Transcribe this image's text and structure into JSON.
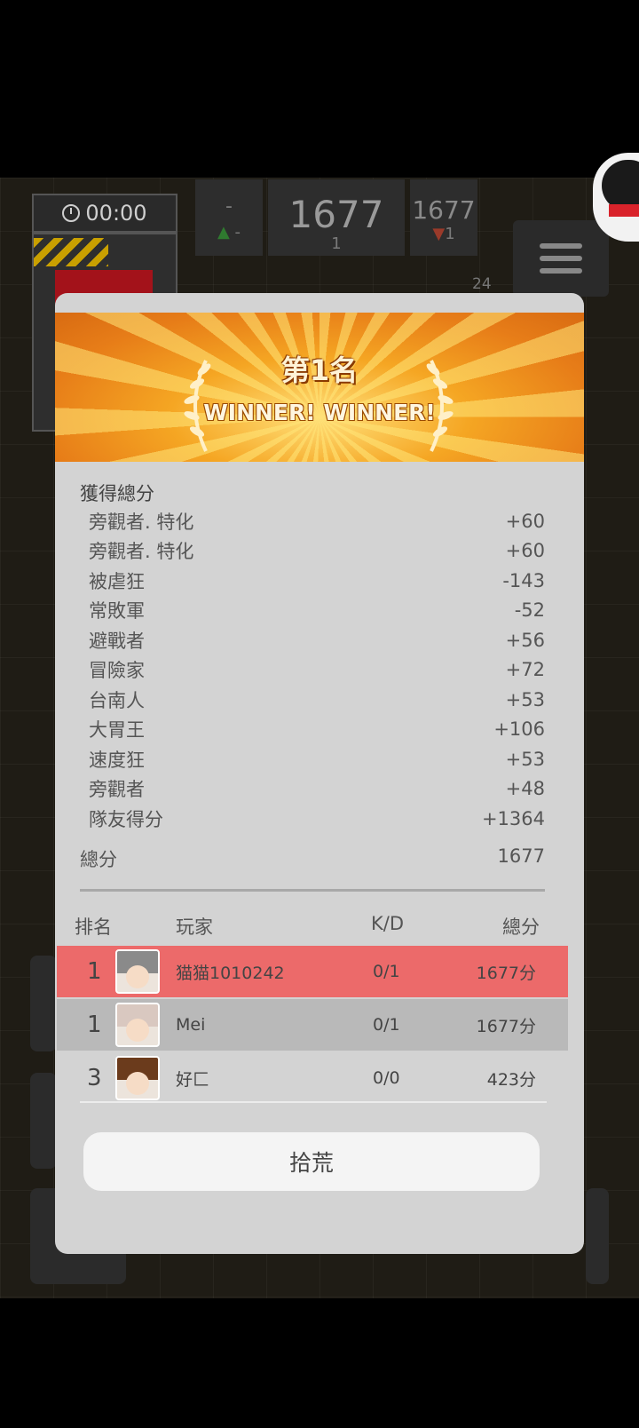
{
  "hud": {
    "timer": "00:00",
    "stat1_top": "-",
    "stat1_bottom": "-",
    "stat2_value": "1677",
    "stat2_sub": "1",
    "stat3_value": "1677",
    "stat3_sub": "1",
    "counter": "24"
  },
  "banner": {
    "title": "第1名",
    "subtitle": "WINNER! WINNER!"
  },
  "breakdown": {
    "section_label": "獲得總分",
    "items": [
      {
        "label": "旁觀者. 特化",
        "value": "+60"
      },
      {
        "label": "旁觀者. 特化",
        "value": "+60"
      },
      {
        "label": "被虐狂",
        "value": "-143"
      },
      {
        "label": "常敗軍",
        "value": "-52"
      },
      {
        "label": "避戰者",
        "value": "+56"
      },
      {
        "label": "冒險家",
        "value": "+72"
      },
      {
        "label": "台南人",
        "value": "+53"
      },
      {
        "label": "大胃王",
        "value": "+106"
      },
      {
        "label": "速度狂",
        "value": "+53"
      },
      {
        "label": "旁觀者",
        "value": "+48"
      },
      {
        "label": "隊友得分",
        "value": "+1364"
      }
    ],
    "total_label": "總分",
    "total_value": "1677"
  },
  "ranking": {
    "headers": {
      "rank": "排名",
      "player": "玩家",
      "kd": "K/D",
      "score": "總分"
    },
    "rows": [
      {
        "rank": "1",
        "player": "猫猫1010242",
        "kd": "0/1",
        "score": "1677分",
        "highlight": "#ec6a6a",
        "avatar_hair": "#8a8a8a"
      },
      {
        "rank": "1",
        "player": "Mei",
        "kd": "0/1",
        "score": "1677分",
        "highlight": "#b9b9b9",
        "avatar_hair": "#d9c8c0"
      },
      {
        "rank": "3",
        "player": "好匚",
        "kd": "0/0",
        "score": "423分",
        "highlight": "#d3d3d3",
        "avatar_hair": "#6b3b1c"
      }
    ]
  },
  "action": {
    "label": "拾荒"
  }
}
